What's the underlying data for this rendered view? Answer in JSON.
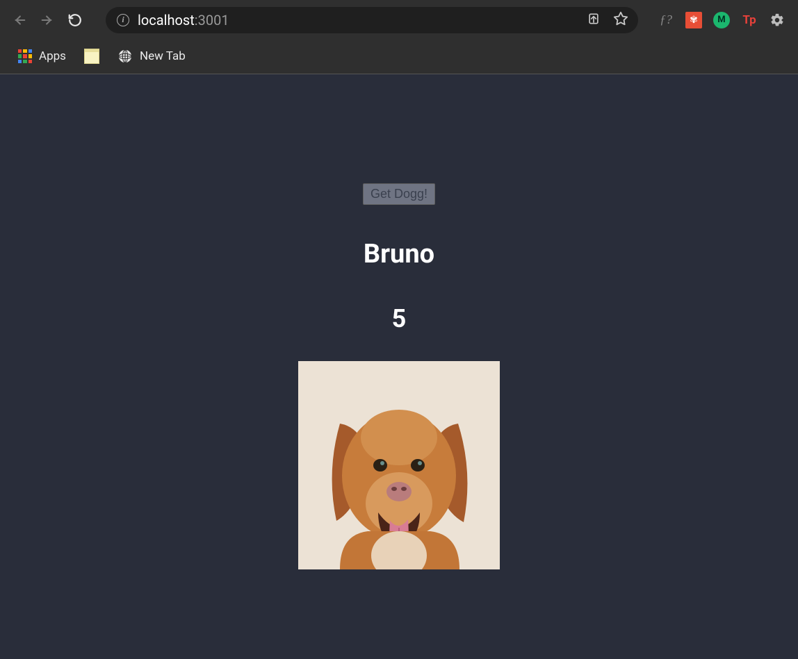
{
  "browser": {
    "url": {
      "host": "localhost",
      "port": ":3001"
    },
    "bookmarks": {
      "apps_label": "Apps",
      "new_tab_label": "New Tab"
    },
    "extensions": {
      "f_label": "ƒ?",
      "red_label": "✾",
      "green_label": "M",
      "tp_label": "Tp"
    }
  },
  "main": {
    "button_label": "Get Dogg!",
    "dog_name": "Bruno",
    "dog_number": "5"
  }
}
